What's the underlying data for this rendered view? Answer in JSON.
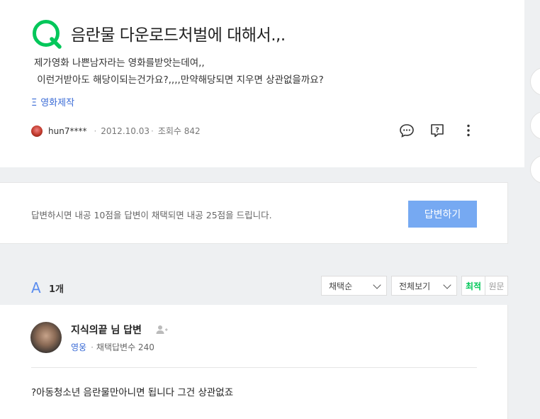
{
  "question": {
    "title": "음란물 다운로드처벌에 대해서.,.",
    "body_line1": "제가영화 나쁜남자라는 영화를받앗는데여,,",
    "body_line2": " 이런거받아도 해당이되는건가요?,,,,만약해당되면 지우면 상관없을까요?",
    "category": "영화제작",
    "author": "hun7****",
    "date": "2012.10.03",
    "views": "조회수 842",
    "icons": [
      "comment-icon",
      "report-icon",
      "more-icon"
    ]
  },
  "answer_prompt": {
    "text": "답변하시면 내공 10점을 답변이 채택되면 내공 25점을 드립니다.",
    "button": "답변하기"
  },
  "answers_header": {
    "count": "1개",
    "sort_select": "채택순",
    "view_select": "전체보기",
    "toggle_recent": "최적",
    "toggle_original": "원문"
  },
  "answer": {
    "name": "지식의끝 님 답변",
    "grade": "영웅",
    "adopted": "채택답변수 240",
    "body": "?아동청소년 음란물만아니면 됩니다 그건 상관없죠"
  },
  "colors": {
    "accent_green": "#03c75a",
    "accent_blue": "#3a6bd6",
    "button_blue": "#76a9f2"
  }
}
